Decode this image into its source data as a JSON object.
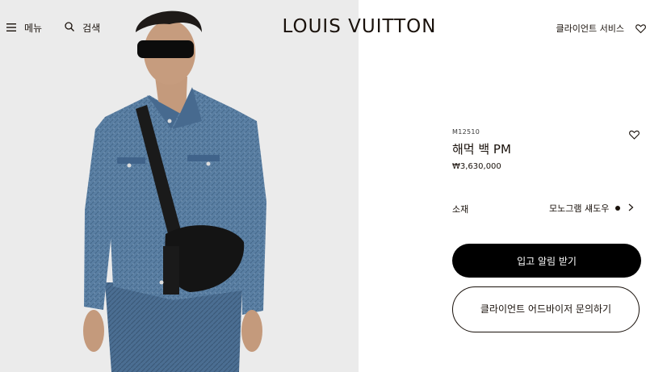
{
  "header": {
    "menu_label": "메뉴",
    "search_label": "검색",
    "brand": "LOUIS VUITTON",
    "client_service_label": "클라이언트 서비스"
  },
  "product": {
    "sku": "M12510",
    "name": "해먹 백 PM",
    "price": "₩3,630,000",
    "material_label": "소재",
    "material_value": "모노그램 섀도우"
  },
  "actions": {
    "notify_label": "입고 알림 받기",
    "advisor_label": "클라이언트 어드바이저 문의하기"
  },
  "colors": {
    "hero_background": "#ebebeb",
    "primary_button": "#000000",
    "text": "#19110b"
  },
  "icons": [
    "hamburger-icon",
    "search-icon",
    "heart-icon",
    "chevron-right-icon"
  ]
}
